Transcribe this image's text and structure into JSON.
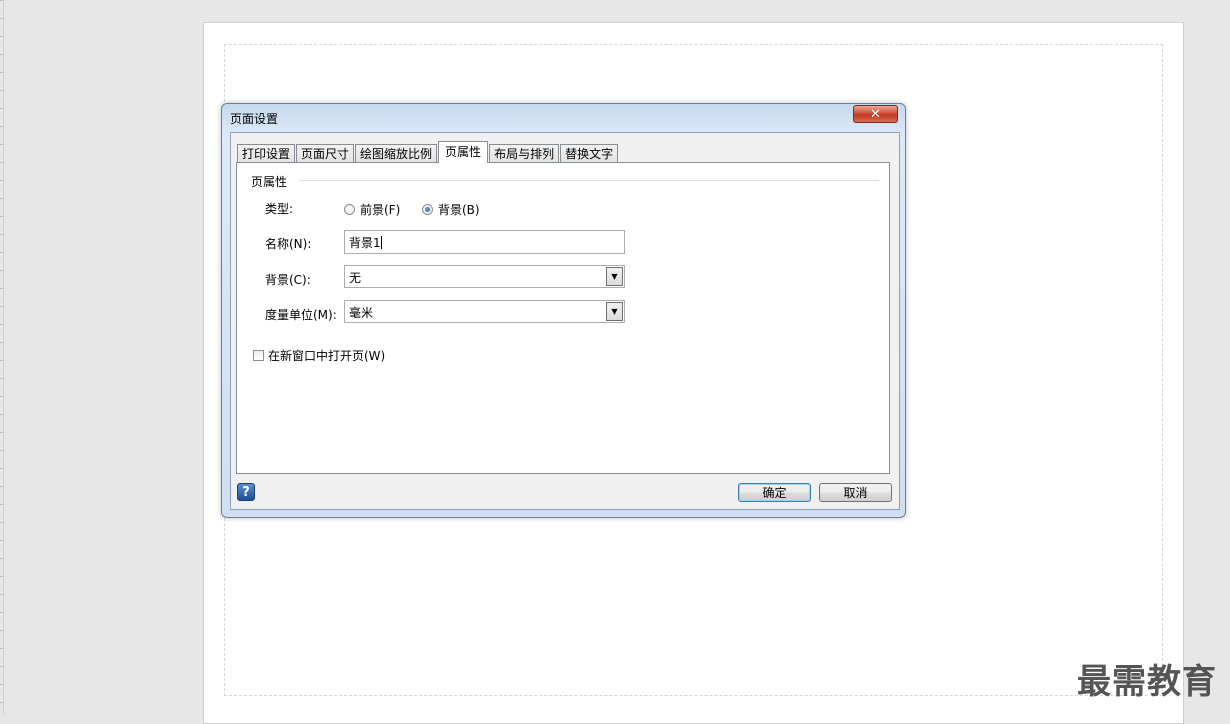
{
  "dialog": {
    "title": "页面设置",
    "close_glyph": "✕",
    "tabs": [
      "打印设置",
      "页面尺寸",
      "绘图缩放比例",
      "页属性",
      "布局与排列",
      "替换文字"
    ],
    "active_tab": "页属性",
    "group_label": "页属性",
    "type_label": "类型:",
    "radio_foreground": "前景(F)",
    "radio_background": "背景(B)",
    "selected_type": "背景(B)",
    "name_label": "名称(N):",
    "name_value": "背景1",
    "background_label": "背景(C):",
    "background_value": "无",
    "unit_label": "度量单位(M):",
    "unit_value": "毫米",
    "open_new_window_label": "在新窗口中打开页(W)",
    "open_new_window_checked": false,
    "help_glyph": "?",
    "ok_label": "确定",
    "cancel_label": "取消"
  },
  "watermark": "最需教育"
}
